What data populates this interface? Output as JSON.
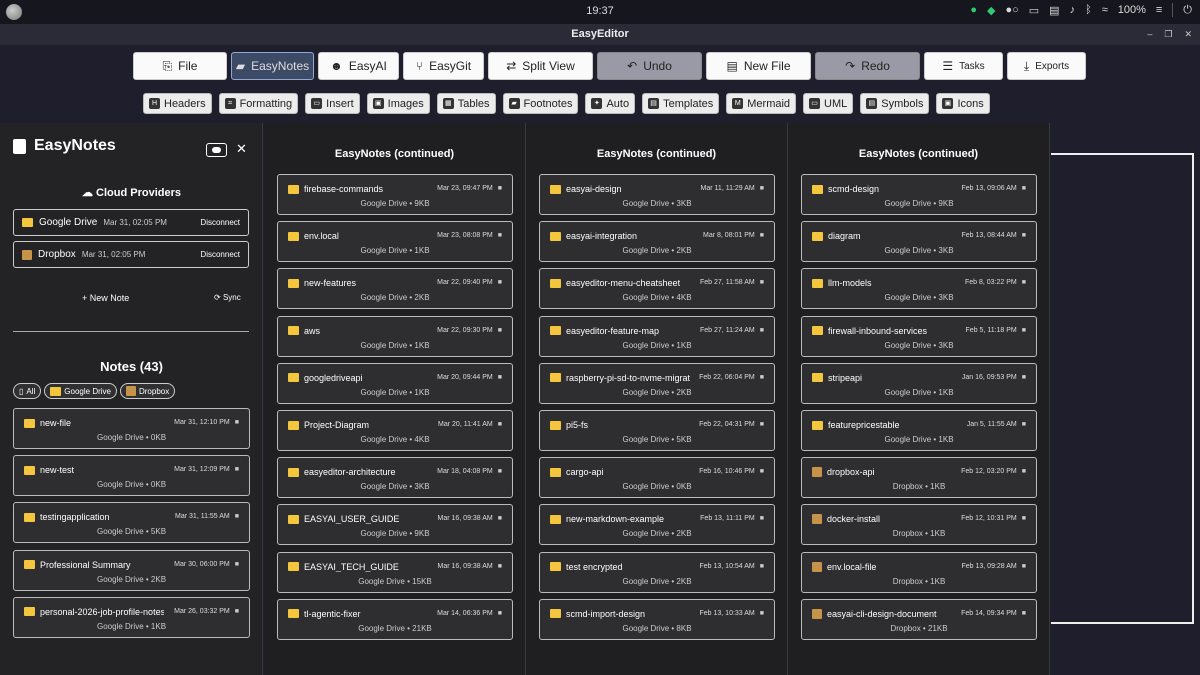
{
  "system": {
    "clock": "19:37",
    "battery": "100%"
  },
  "window": {
    "title": "EasyEditor"
  },
  "toolbar": {
    "buttons": [
      {
        "label": "File",
        "icon": "file-icon",
        "w": 94,
        "style": ""
      },
      {
        "label": "EasyNotes",
        "icon": "note-icon",
        "w": 83,
        "style": "active"
      },
      {
        "label": "EasyAI",
        "icon": "robot-icon",
        "w": 81,
        "style": ""
      },
      {
        "label": "EasyGit",
        "icon": "git-icon",
        "w": 81,
        "style": ""
      },
      {
        "label": "Split View",
        "icon": "split-icon",
        "w": 105,
        "style": ""
      },
      {
        "label": "Undo",
        "icon": "undo-icon",
        "w": 105,
        "style": "gray"
      },
      {
        "label": "New File",
        "icon": "newfile-icon",
        "w": 105,
        "style": ""
      },
      {
        "label": "Redo",
        "icon": "redo-icon",
        "w": 105,
        "style": "gray"
      },
      {
        "label": "Tasks",
        "icon": "tasks-icon",
        "w": 79,
        "style": "small"
      },
      {
        "label": "Exports",
        "icon": "download-icon",
        "w": 79,
        "style": "small"
      }
    ]
  },
  "toolbar2": {
    "buttons": [
      "Headers",
      "Formatting",
      "Insert",
      "Images",
      "Tables",
      "Footnotes",
      "Auto",
      "Templates",
      "Mermaid",
      "UML",
      "Symbols",
      "Icons"
    ]
  },
  "sidebar": {
    "title": "EasyNotes",
    "cloud_title": "Cloud Providers",
    "providers": [
      {
        "name": "Google Drive",
        "date": "Mar 31, 02:05 PM",
        "action": "Disconnect"
      },
      {
        "name": "Dropbox",
        "date": "Mar 31, 02:05 PM",
        "action": "Disconnect"
      }
    ],
    "new_note": "New Note",
    "sync": "Sync",
    "notes_title": "Notes (43)",
    "filters": [
      "All",
      "Google Drive",
      "Dropbox"
    ],
    "notes": [
      {
        "name": "new-file",
        "date": "Mar 31, 12:10 PM",
        "meta": "Google Drive • 0KB",
        "src": "gd"
      },
      {
        "name": "new-test",
        "date": "Mar 31, 12:09 PM",
        "meta": "Google Drive • 0KB",
        "src": "gd"
      },
      {
        "name": "testingapplication",
        "date": "Mar 31, 11:55 AM",
        "meta": "Google Drive • 5KB",
        "src": "gd"
      },
      {
        "name": "Professional Summary",
        "date": "Mar 30, 06:00 PM",
        "meta": "Google Drive • 2KB",
        "src": "gd"
      },
      {
        "name": "personal-2026-job-profile-notes",
        "date": "Mar 26, 03:32 PM",
        "meta": "Google Drive • 1KB",
        "src": "gd"
      }
    ]
  },
  "columns": [
    {
      "title": "EasyNotes (continued)",
      "notes": [
        {
          "name": "firebase-commands",
          "date": "Mar 23, 09:47 PM",
          "meta": "Google Drive • 9KB",
          "src": "gd"
        },
        {
          "name": "env.local",
          "date": "Mar 23, 08:08 PM",
          "meta": "Google Drive • 1KB",
          "src": "gd"
        },
        {
          "name": "new-features",
          "date": "Mar 22, 09:40 PM",
          "meta": "Google Drive • 2KB",
          "src": "gd"
        },
        {
          "name": "aws",
          "date": "Mar 22, 09:30 PM",
          "meta": "Google Drive • 1KB",
          "src": "gd"
        },
        {
          "name": "googledriveapi",
          "date": "Mar 20, 09:44 PM",
          "meta": "Google Drive • 1KB",
          "src": "gd"
        },
        {
          "name": "Project-Diagram",
          "date": "Mar 20, 11:41 AM",
          "meta": "Google Drive • 4KB",
          "src": "gd"
        },
        {
          "name": "easyeditor-architecture",
          "date": "Mar 18, 04:08 PM",
          "meta": "Google Drive • 3KB",
          "src": "gd"
        },
        {
          "name": "EASYAI_USER_GUIDE",
          "date": "Mar 16, 09:38 AM",
          "meta": "Google Drive • 9KB",
          "src": "gd"
        },
        {
          "name": "EASYAI_TECH_GUIDE",
          "date": "Mar 16, 09:38 AM",
          "meta": "Google Drive • 15KB",
          "src": "gd"
        },
        {
          "name": "tl-agentic-fixer",
          "date": "Mar 14, 06:36 PM",
          "meta": "Google Drive • 21KB",
          "src": "gd"
        }
      ]
    },
    {
      "title": "EasyNotes (continued)",
      "notes": [
        {
          "name": "easyai-design",
          "date": "Mar 11, 11:29 AM",
          "meta": "Google Drive • 3KB",
          "src": "gd"
        },
        {
          "name": "easyai-integration",
          "date": "Mar 8, 08:01 PM",
          "meta": "Google Drive • 2KB",
          "src": "gd"
        },
        {
          "name": "easyeditor-menu-cheatsheet",
          "date": "Feb 27, 11:58 AM",
          "meta": "Google Drive • 4KB",
          "src": "gd"
        },
        {
          "name": "easyeditor-feature-map",
          "date": "Feb 27, 11:24 AM",
          "meta": "Google Drive • 1KB",
          "src": "gd"
        },
        {
          "name": "raspberry-pi-sd-to-nvme-migrat…",
          "date": "Feb 22, 06:04 PM",
          "meta": "Google Drive • 2KB",
          "src": "gd"
        },
        {
          "name": "pi5-fs",
          "date": "Feb 22, 04:31 PM",
          "meta": "Google Drive • 5KB",
          "src": "gd"
        },
        {
          "name": "cargo-api",
          "date": "Feb 16, 10:46 PM",
          "meta": "Google Drive • 0KB",
          "src": "gd"
        },
        {
          "name": "new-markdown-example",
          "date": "Feb 13, 11:11 PM",
          "meta": "Google Drive • 2KB",
          "src": "gd"
        },
        {
          "name": "test encrypted",
          "date": "Feb 13, 10:54 AM",
          "meta": "Google Drive • 2KB",
          "src": "gd"
        },
        {
          "name": "scmd-import-design",
          "date": "Feb 13, 10:33 AM",
          "meta": "Google Drive • 8KB",
          "src": "gd"
        }
      ]
    },
    {
      "title": "EasyNotes (continued)",
      "notes": [
        {
          "name": "scmd-design",
          "date": "Feb 13, 09:06 AM",
          "meta": "Google Drive • 9KB",
          "src": "gd"
        },
        {
          "name": "diagram",
          "date": "Feb 13, 08:44 AM",
          "meta": "Google Drive • 3KB",
          "src": "gd"
        },
        {
          "name": "llm-models",
          "date": "Feb 8, 03:22 PM",
          "meta": "Google Drive • 3KB",
          "src": "gd"
        },
        {
          "name": "firewall-inbound-services",
          "date": "Feb 5, 11:18 PM",
          "meta": "Google Drive • 3KB",
          "src": "gd"
        },
        {
          "name": "stripeapi",
          "date": "Jan 16, 09:53 PM",
          "meta": "Google Drive • 1KB",
          "src": "gd"
        },
        {
          "name": "featurepricestable",
          "date": "Jan 5, 11:55 AM",
          "meta": "Google Drive • 1KB",
          "src": "gd"
        },
        {
          "name": "dropbox-api",
          "date": "Feb 12, 03:20 PM",
          "meta": "Dropbox • 1KB",
          "src": "db"
        },
        {
          "name": "docker-install",
          "date": "Feb 12, 10:31 PM",
          "meta": "Dropbox • 1KB",
          "src": "db"
        },
        {
          "name": "env.local-file",
          "date": "Feb 13, 09:28 AM",
          "meta": "Dropbox • 1KB",
          "src": "db"
        },
        {
          "name": "easyai-cli-design-document",
          "date": "Feb 14, 09:34 PM",
          "meta": "Dropbox • 21KB",
          "src": "db"
        }
      ]
    }
  ]
}
